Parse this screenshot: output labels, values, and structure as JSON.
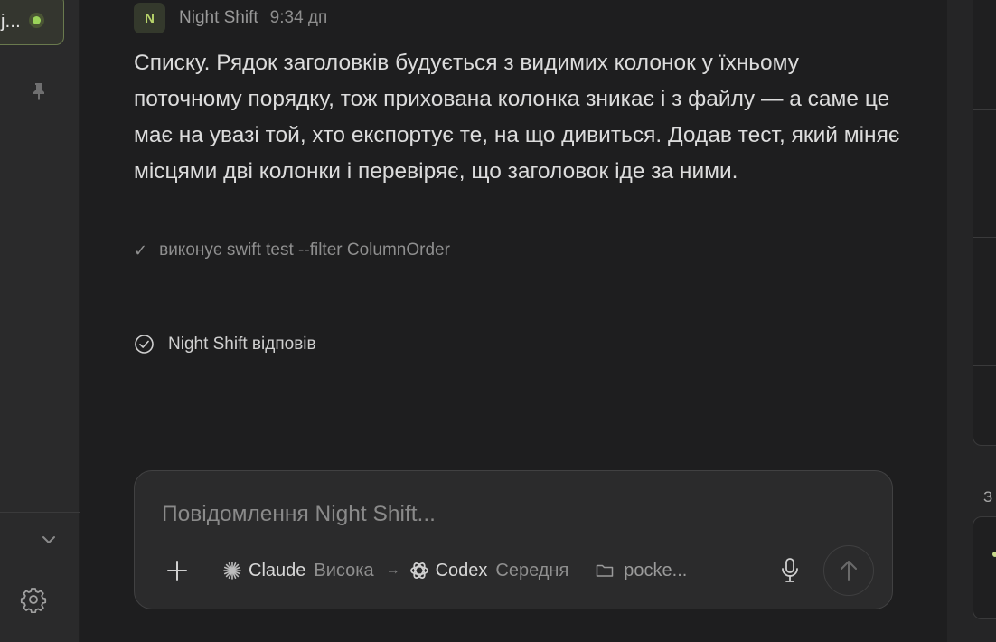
{
  "sidebar": {
    "active_item_label": "ј...",
    "active_item_status_color": "#9bd35a",
    "icons": {
      "pin": "pin-icon",
      "expand": "chevron-down-icon",
      "settings": "gear-icon"
    }
  },
  "message": {
    "avatar_letter": "N",
    "sender": "Night Shift",
    "time": "9:34 дп",
    "body": "Списку. Рядок заголовків будується з видимих колонок у їхньому поточному порядку, тож прихована колонка зникає і з файлу — а саме це має на увазі той, хто експортує те, на що дивиться. Додав тест, який міняє місцями дві колонки і перевіряє, що заголовок іде за ними.",
    "tool_call": "виконує swift test --filter ColumnOrder",
    "status": "Night Shift відповів"
  },
  "composer": {
    "placeholder": "Повідомлення Night Shift...",
    "planner_model": "Claude",
    "planner_level": "Висока",
    "arrow": "→",
    "executor_model": "Codex",
    "executor_level": "Середня",
    "folder": "pocke..."
  },
  "right_panel": {
    "label": "З"
  },
  "colors": {
    "accent": "#b7d36a",
    "background": "#1e1e1f",
    "sidebar": "#2a2a2b",
    "composer": "#2b2b2c"
  }
}
